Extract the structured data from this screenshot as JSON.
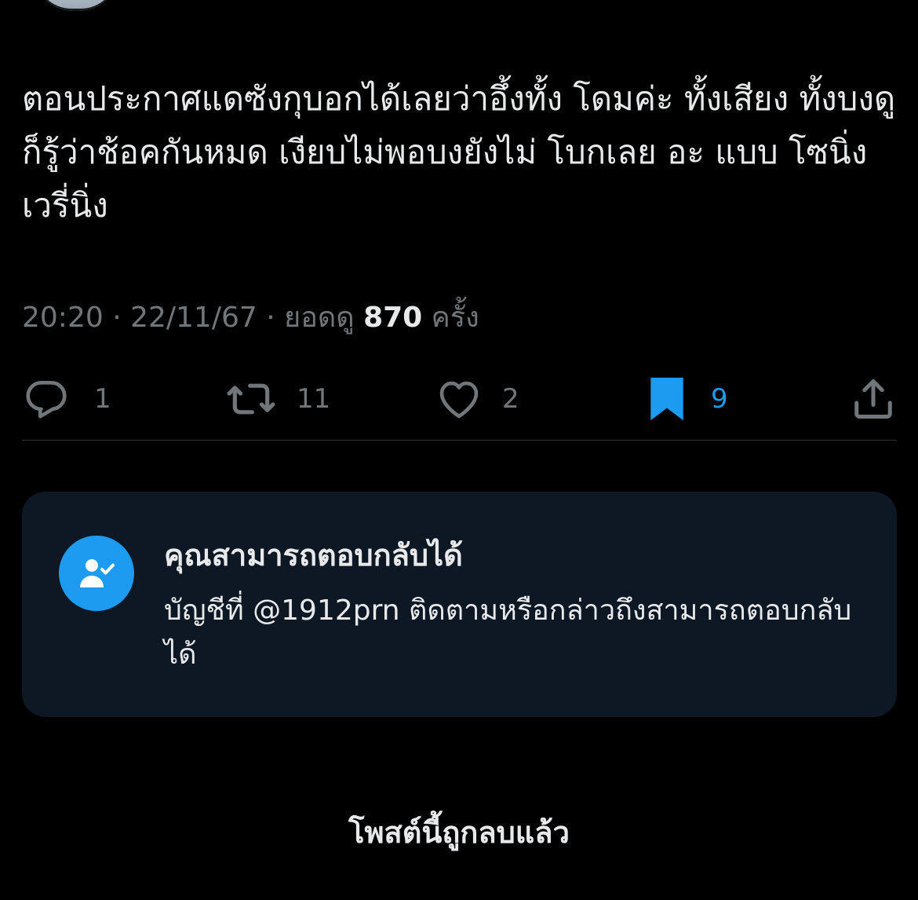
{
  "post": {
    "text": "ตอนประกาศแดซังกุบอกได้เลยว่าอึ้งทั้ง โดมค่ะ ทั้งเสียง ทั้งบงดูก็รู้ว่าช้อคกันหมด เงียบไม่พอบงยังไม่ โบกเลย อะ แบบ โซนิ่งเวรี่นิ่ง",
    "time": "20:20",
    "date": "22/11/67",
    "views_label": "ยอดดู",
    "views_count": "870",
    "views_unit": "ครั้ง",
    "separator": " · "
  },
  "actions": {
    "reply_count": "1",
    "repost_count": "11",
    "like_count": "2",
    "bookmark_count": "9",
    "bookmarked": true
  },
  "reply_notice": {
    "title": "คุณสามารถตอบกลับได้",
    "description": "บัญชีที่ @1912prn ติดตามหรือกล่าวถึงสามารถตอบกลับได้"
  },
  "deleted_notice": "โพสต์นี้ถูกลบแล้ว",
  "colors": {
    "background": "#000000",
    "text_primary": "#e7e9ea",
    "text_secondary": "#71767b",
    "accent": "#1d9bf0",
    "card_background": "#0e1824"
  },
  "icons": {
    "reply": "reply-icon",
    "repost": "repost-icon",
    "like": "heart-icon",
    "bookmark": "bookmark-icon",
    "share": "share-icon",
    "reply_permission": "user-check-icon"
  }
}
